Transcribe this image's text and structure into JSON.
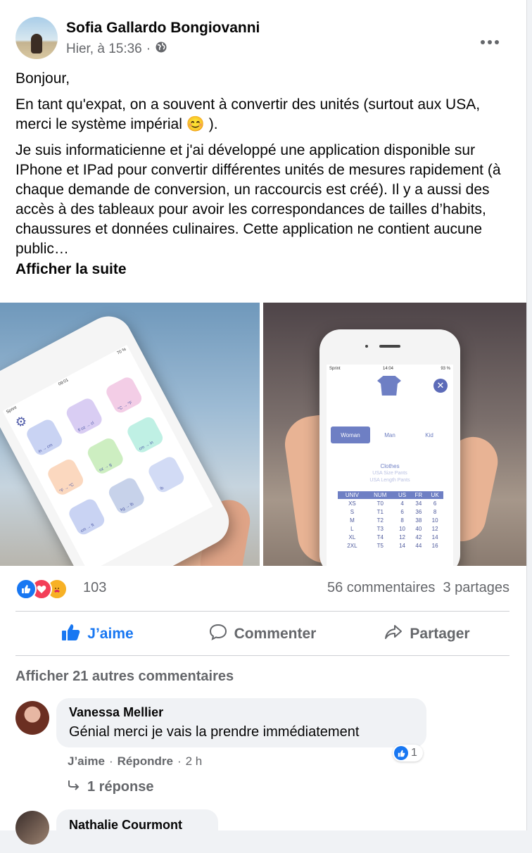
{
  "post": {
    "author": "Sofia Gallardo Bongiovanni",
    "timestamp": "Hier, à 15:36",
    "separator": "·",
    "privacy_icon": "globe-icon",
    "more_icon": "more-options-icon",
    "paragraphs": [
      "Bonjour,",
      "En tant qu'expat, on a souvent à convertir des unités (surtout aux USA, merci le système impérial 😊 ).",
      "Je suis informaticienne et j'ai développé une application disponible sur IPhone et IPad pour convertir différentes unités de mesures rapidement (à chaque demande de conversion, un raccourcis est créé). Il y a aussi des accès à des tableaux pour avoir les correspondances de tailles d’habits, chaussures et données culinaires. Cette application ne contient aucune public…"
    ],
    "see_more": "Afficher la suite"
  },
  "images": {
    "left": {
      "status_carrier": "Sprint",
      "status_time": "09:01",
      "status_battery": "70 %",
      "tiles": [
        {
          "label": "in → cm",
          "color": "#c9d3f3"
        },
        {
          "label": "fl oz → cl",
          "color": "#d9cdf3"
        },
        {
          "label": "°C → °F",
          "color": "#f3cde6"
        },
        {
          "label": "°F → °C",
          "color": "#fbd8bf"
        },
        {
          "label": "oz → g",
          "color": "#cdeec1"
        },
        {
          "label": "cm → in",
          "color": "#bff0e4"
        },
        {
          "label": "cm → ft",
          "color": "#c9d3f3"
        },
        {
          "label": "kg → lb",
          "color": "#c7d2ea"
        },
        {
          "label": "lb",
          "color": "#d2dbf5"
        }
      ]
    },
    "right": {
      "status_carrier": "Sprint",
      "status_time": "14:04",
      "status_battery": "93 %",
      "tabs": [
        "Woman",
        "Man",
        "Kid"
      ],
      "section_title": "Clothes",
      "section_sub1": "USA Size Pants",
      "section_sub2": "USA Length Pants",
      "table_headers": [
        "UNIV",
        "NUM",
        "US",
        "FR",
        "UK"
      ],
      "table_rows": [
        [
          "XS",
          "T0",
          "4",
          "34",
          "6"
        ],
        [
          "S",
          "T1",
          "6",
          "36",
          "8"
        ],
        [
          "M",
          "T2",
          "8",
          "38",
          "10"
        ],
        [
          "L",
          "T3",
          "10",
          "40",
          "12"
        ],
        [
          "XL",
          "T4",
          "12",
          "42",
          "14"
        ],
        [
          "2XL",
          "T5",
          "14",
          "44",
          "16"
        ]
      ]
    }
  },
  "reactions": {
    "count": "103",
    "comments": "56 commentaires",
    "shares": "3 partages",
    "icons": [
      "like-reaction-icon",
      "love-reaction-icon",
      "care-reaction-icon"
    ],
    "colors": {
      "like": "#1877f2",
      "love": "#f33e58",
      "care": "#f7b125"
    }
  },
  "actions": {
    "like": "J’aime",
    "comment": "Commenter",
    "share": "Partager",
    "liked_color": "#1877f2"
  },
  "comments": {
    "more_label": "Afficher 21 autres commentaires",
    "items": [
      {
        "author": "Vanessa Mellier",
        "text": "Génial merci je vais la prendre immédiatement",
        "like_label": "J’aime",
        "reply_label": "Répondre",
        "time": "2 h",
        "like_count": "1",
        "replies": "1 réponse"
      },
      {
        "author": "Nathalie Courmont"
      }
    ]
  }
}
